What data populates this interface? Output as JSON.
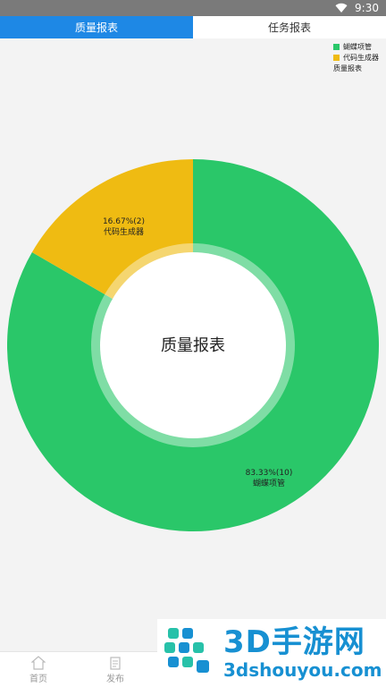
{
  "status_bar": {
    "time": "9:30",
    "icons": [
      "wifi-icon",
      "signal-icon",
      "battery-icon"
    ]
  },
  "tabs": [
    {
      "label": "质量报表",
      "active": true
    },
    {
      "label": "任务报表",
      "active": false
    }
  ],
  "legend": {
    "items": [
      {
        "label": "蝴蝶项管",
        "color": "#2ac769"
      },
      {
        "label": "代码生成器",
        "color": "#efbb12"
      }
    ],
    "title": "质量报表"
  },
  "chart_data": {
    "type": "pie",
    "title": "质量报表",
    "donut": true,
    "categories": [
      "蝴蝶项管",
      "代码生成器"
    ],
    "values": [
      10,
      2
    ],
    "percentages": [
      "83.33%",
      "16.67%"
    ],
    "labels": [
      "83.33%(10)",
      "16.67%(2)"
    ],
    "colors": [
      "#2ac769",
      "#efbb12"
    ],
    "legend_position": "top-right"
  },
  "bottom_nav": [
    {
      "label": "首页",
      "icon": "home-icon"
    },
    {
      "label": "发布",
      "icon": "publish-icon"
    }
  ],
  "watermark": {
    "title": "3D手游网",
    "url": "3dshouyou.com"
  }
}
